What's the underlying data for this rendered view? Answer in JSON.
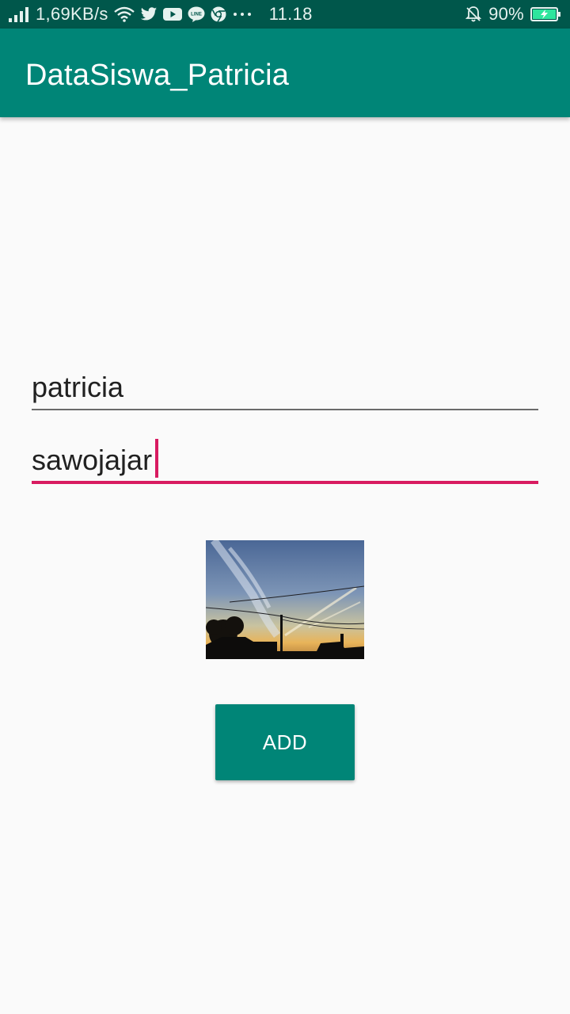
{
  "status_bar": {
    "network_speed": "1,69KB/s",
    "time": "11.18",
    "battery": "90%",
    "icons": [
      "signal-icon",
      "wifi-icon",
      "twitter-icon",
      "youtube-icon",
      "line-icon",
      "chrome-icon",
      "more-dots-icon",
      "bell-off-icon",
      "battery-charging-icon"
    ]
  },
  "app_bar": {
    "title": "DataSiswa_Patricia"
  },
  "form": {
    "name_value": "patricia",
    "address_value": "sawojajar"
  },
  "photo": {
    "description_icon": "sunset-photo"
  },
  "button": {
    "add_label": "ADD"
  },
  "colors": {
    "primary": "#008577",
    "primary_dark": "#00574b",
    "accent": "#d81b60",
    "background": "#fafafa"
  }
}
